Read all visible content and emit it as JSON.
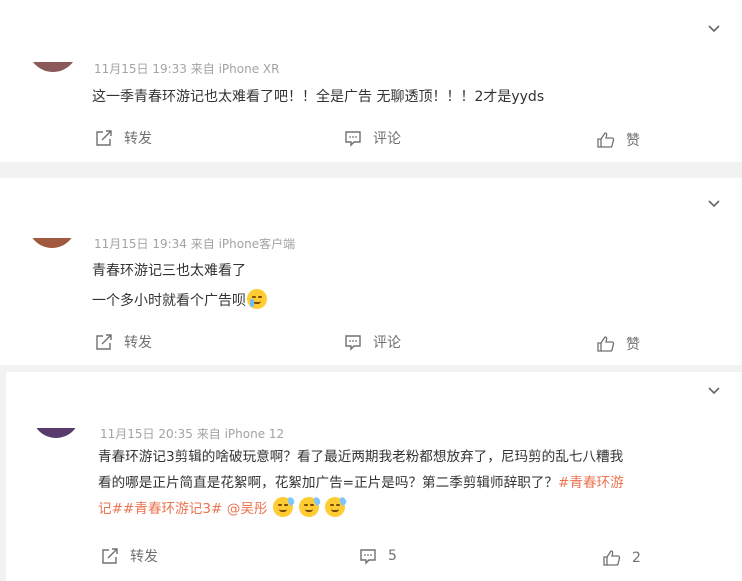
{
  "comments": [
    {
      "meta": "11月15日 19:33 来自 iPhone XR",
      "lines": [
        "这一季青春环游记也太难看了吧！！全是广告 无聊透顶！！！2才是yyds"
      ],
      "repost_label": "转发",
      "comment_label": "评论",
      "like_label": "赞"
    },
    {
      "meta": "11月15日 19:34 来自 iPhone客户端",
      "lines": [
        "青春环游记三也太难看了",
        "一个多小时就看个广告呗"
      ],
      "emoji": "cry",
      "repost_label": "转发",
      "comment_label": "评论",
      "like_label": "赞"
    },
    {
      "meta": "11月15日 20:35 来自 iPhone 12",
      "line1": "青春环游记3剪辑的啥破玩意啊？看了最近两期我老粉都想放弃了，尼玛剪的乱七八糟我",
      "line2": "看的哪是正片简直是花絮啊，花絮加广告=正片是吗？第二季剪辑师辞职了？",
      "tag1_part1": "#青春环游",
      "tag1_part2": "记#",
      "tag2": "#青春环游记3#",
      "mention": "@吴彤",
      "emojis": [
        "sweat",
        "sweat",
        "sweat"
      ],
      "repost_label": "转发",
      "comment_count": "5",
      "like_count": "2"
    }
  ],
  "colors": {
    "accent": "#eb7350",
    "text": "#333333",
    "muted": "#a3a3a3",
    "action": "#707070",
    "separator": "#f2f2f2"
  },
  "icons": [
    "chevron-down-icon",
    "repost-icon",
    "comment-icon",
    "like-icon"
  ]
}
